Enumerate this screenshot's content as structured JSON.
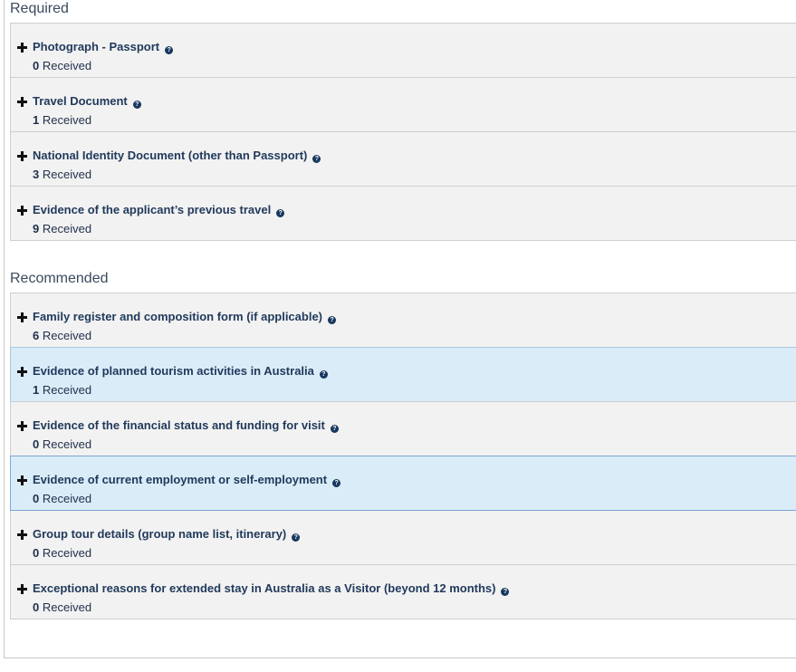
{
  "sections": [
    {
      "title": "Required",
      "items": [
        {
          "title": "Photograph - Passport",
          "count": "0",
          "suffix": "Received"
        },
        {
          "title": "Travel Document",
          "count": "1",
          "suffix": "Received"
        },
        {
          "title": "National Identity Document (other than Passport)",
          "count": "3",
          "suffix": "Received"
        },
        {
          "title": "Evidence of the applicant’s previous travel",
          "count": "9",
          "suffix": "Received"
        }
      ]
    },
    {
      "title": "Recommended",
      "items": [
        {
          "title": "Family register and composition form (if applicable)",
          "count": "6",
          "suffix": "Received"
        },
        {
          "title": "Evidence of planned tourism activities in Australia",
          "count": "1",
          "suffix": "Received",
          "highlight": true
        },
        {
          "title": "Evidence of the financial status and funding for visit",
          "count": "0",
          "suffix": "Received"
        },
        {
          "title": "Evidence of current employment or self-employment",
          "count": "0",
          "suffix": "Received",
          "highlight": true,
          "selected": true
        },
        {
          "title": "Group tour details (group name list, itinerary)",
          "count": "0",
          "suffix": "Received"
        },
        {
          "title": "Exceptional reasons for extended stay in Australia as a Visitor (beyond 12 months)",
          "count": "0",
          "suffix": "Received"
        }
      ]
    }
  ],
  "help_icon_glyph": "?",
  "colors": {
    "item_bg": "#f2f2f2",
    "highlight_bg": "#daecf8",
    "title_text": "#213a5c",
    "help_icon": "#17375e"
  }
}
